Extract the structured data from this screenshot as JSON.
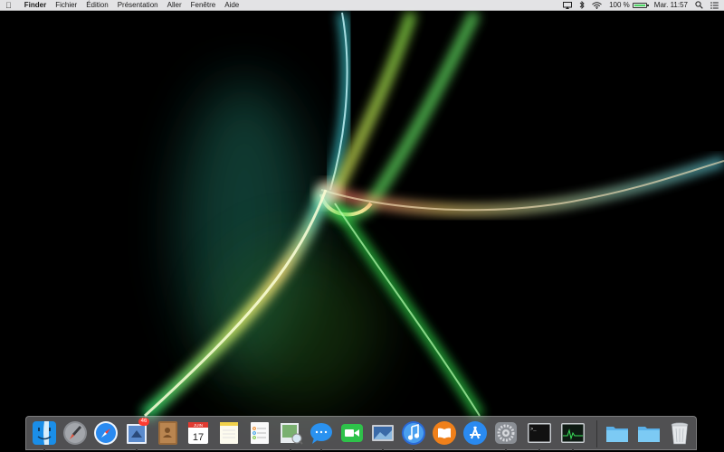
{
  "menubar": {
    "apple_icon": "apple-logo-icon",
    "app_name": "Finder",
    "menus": [
      "Fichier",
      "Édition",
      "Présentation",
      "Aller",
      "Fenêtre",
      "Aide"
    ],
    "status": {
      "battery_percent": "100 %",
      "battery_level": 1.0,
      "clock": "Mar. 11:57"
    }
  },
  "dock": {
    "apps": [
      {
        "name": "Finder",
        "icon": "finder-icon",
        "running": true
      },
      {
        "name": "Launchpad",
        "icon": "launchpad-icon",
        "running": false
      },
      {
        "name": "Safari",
        "icon": "safari-icon",
        "running": false
      },
      {
        "name": "Mail",
        "icon": "mail-icon",
        "running": true,
        "badge": "46"
      },
      {
        "name": "Contacts",
        "icon": "contacts-icon",
        "running": false
      },
      {
        "name": "Calendrier",
        "icon": "calendar-icon",
        "running": false,
        "month": "JUIN",
        "day": "17"
      },
      {
        "name": "Notes",
        "icon": "notes-icon",
        "running": false
      },
      {
        "name": "Rappels",
        "icon": "reminders-icon",
        "running": false
      },
      {
        "name": "Aperçu",
        "icon": "preview-icon",
        "running": true
      },
      {
        "name": "Messages",
        "icon": "messages-icon",
        "running": true
      },
      {
        "name": "FaceTime",
        "icon": "facetime-icon",
        "running": false
      },
      {
        "name": "Photo Booth",
        "icon": "photo-icon",
        "running": true
      },
      {
        "name": "iTunes",
        "icon": "itunes-icon",
        "running": true
      },
      {
        "name": "iBooks",
        "icon": "ibooks-icon",
        "running": false
      },
      {
        "name": "App Store",
        "icon": "app-store-icon",
        "running": false
      },
      {
        "name": "Préférences Système",
        "icon": "system-preferences-icon",
        "running": true
      },
      {
        "name": "Terminal",
        "icon": "terminal-icon",
        "running": true
      },
      {
        "name": "Moniteur d'activité",
        "icon": "activity-monitor-icon",
        "running": true
      }
    ],
    "stacks": [
      {
        "name": "Applications",
        "icon": "folder-icon"
      },
      {
        "name": "Téléchargements",
        "icon": "downloads-folder-icon"
      },
      {
        "name": "Corbeille",
        "icon": "trash-icon"
      }
    ],
    "terminal_prompt": ">_"
  }
}
